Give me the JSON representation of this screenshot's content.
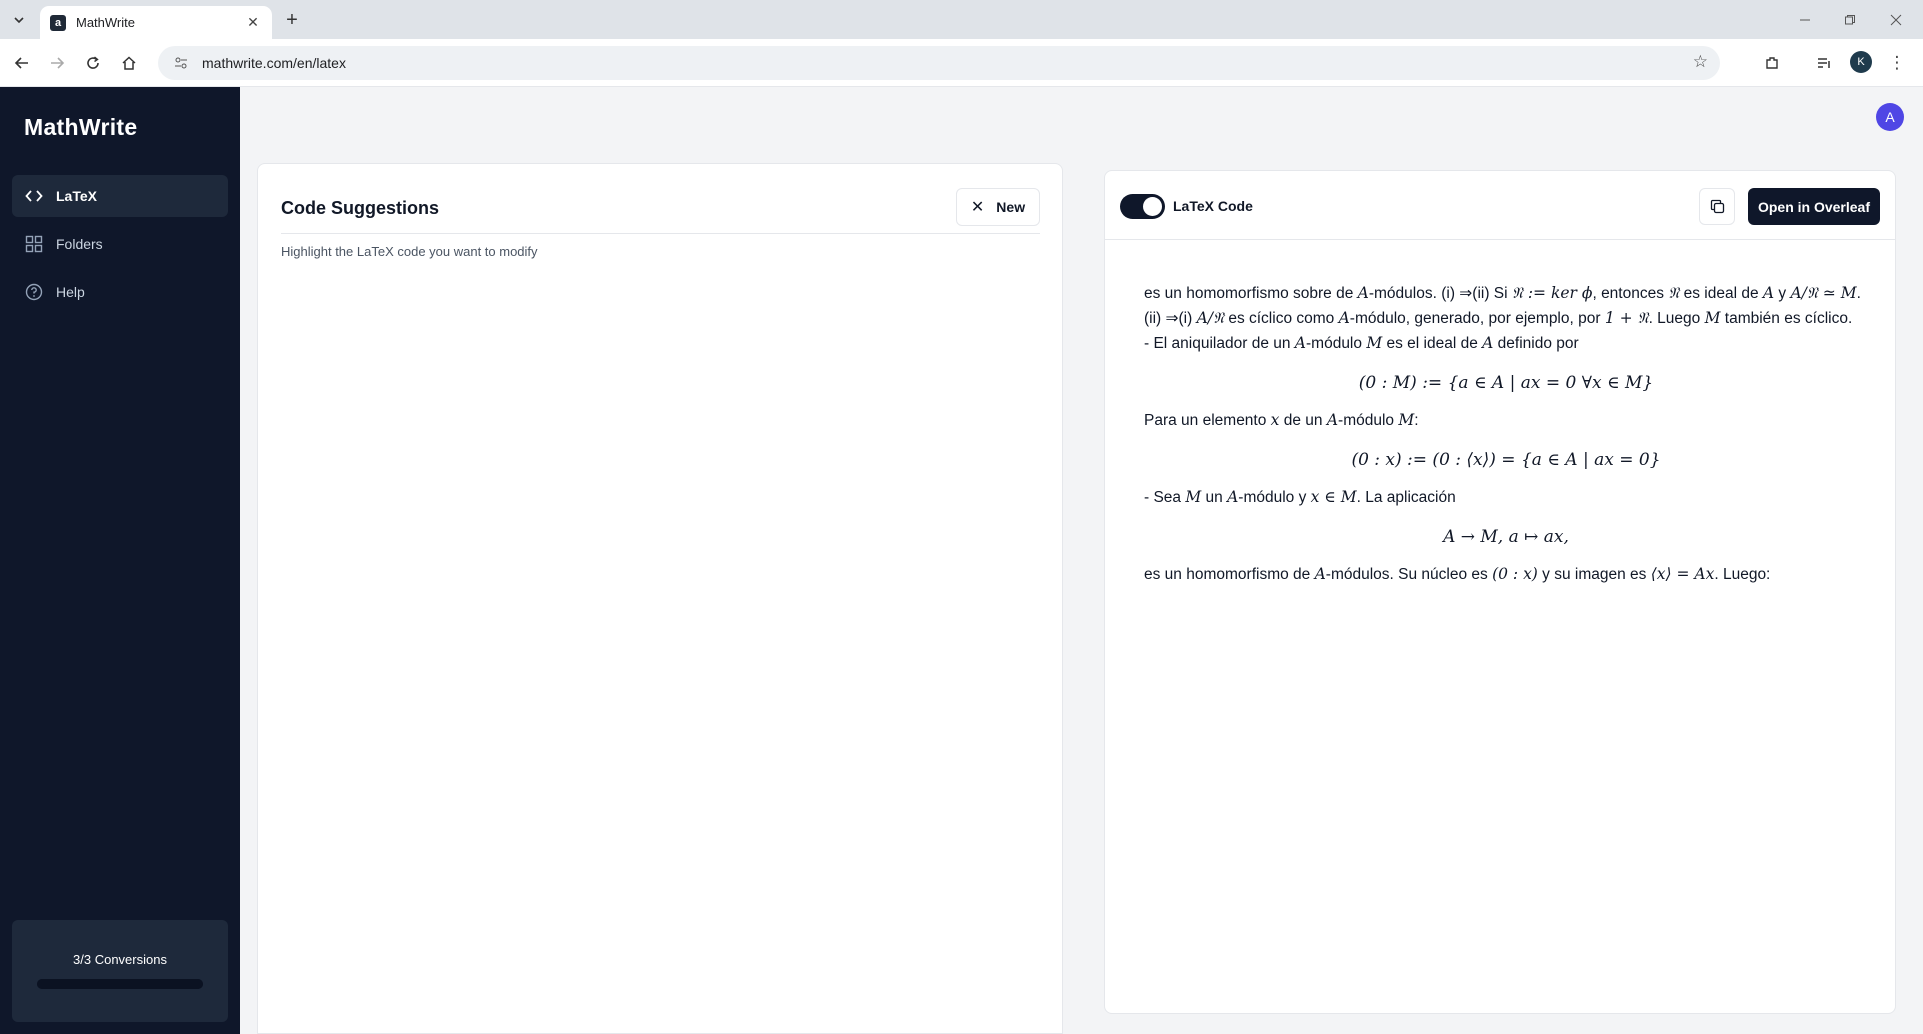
{
  "browser": {
    "tab_title": "MathWrite",
    "favicon_letter": "a",
    "url": "mathwrite.com/en/latex",
    "profile_letter": "K"
  },
  "sidebar": {
    "logo": "MathWrite",
    "items": [
      {
        "label": "LaTeX",
        "icon": "code-icon",
        "active": true
      },
      {
        "label": "Folders",
        "icon": "grid-icon",
        "active": false
      },
      {
        "label": "Help",
        "icon": "help-circle-icon",
        "active": false
      }
    ],
    "conversions": {
      "label": "3/3 Conversions",
      "used": 3,
      "total": 3
    }
  },
  "user": {
    "avatar_letter": "A"
  },
  "code_suggestions": {
    "title": "Code Suggestions",
    "new_button": "New",
    "hint": "Highlight the LaTeX code you want to modify"
  },
  "preview": {
    "toggle_label": "LaTeX Code",
    "toggle_on": true,
    "overleaf_button": "Open in Overleaf",
    "lines": {
      "p1_a": "es un homomorfismo sobre de ",
      "p1_b": "A",
      "p1_c": "-módulos. (i) ⇒(ii) Si ",
      "p1_d": "𝔑 := ker ϕ",
      "p1_e": ", entonces ",
      "p1_f": "𝔑",
      "p1_g": " es ideal de ",
      "p1_h": "A",
      "p1_i": " y ",
      "p1_j": "A/𝔑 ≃ M",
      "p1_k": ". (ii) ⇒(i) ",
      "p1_l": "A/𝔑",
      "p1_m": " es cíclico como ",
      "p1_n": "A",
      "p1_o": "-módulo, generado, por ejemplo, por ",
      "p1_p": "1 + 𝔑",
      "p1_q": ". Luego ",
      "p1_r": "M",
      "p1_s": " también es cíclico.",
      "p2_a": "- El aniquilador de un ",
      "p2_b": "A",
      "p2_c": "-módulo ",
      "p2_d": "M",
      "p2_e": " es el ideal de ",
      "p2_f": "A",
      "p2_g": " definido por",
      "eq1": "(0 : M) := {a ∈ A | ax = 0 ∀x ∈ M}",
      "p3_a": "Para un elemento ",
      "p3_b": "x",
      "p3_c": " de un ",
      "p3_d": "A",
      "p3_e": "-módulo ",
      "p3_f": "M",
      "p3_g": ":",
      "eq2": "(0 : x) := (0 : ⟨x⟩) = {a ∈ A | ax = 0}",
      "p4_a": "- Sea ",
      "p4_b": "M",
      "p4_c": " un ",
      "p4_d": "A",
      "p4_e": "-módulo y ",
      "p4_f": "x ∈ M",
      "p4_g": ". La aplicación",
      "eq3": "A → M,  a ↦ ax,",
      "p5_a": "es un homomorfismo de ",
      "p5_b": "A",
      "p5_c": "-módulos. Su núcleo es ",
      "p5_d": "(0 : x)",
      "p5_e": " y su imagen es ",
      "p5_f": "⟨x⟩ = Ax",
      "p5_g": ". Luego:"
    }
  }
}
